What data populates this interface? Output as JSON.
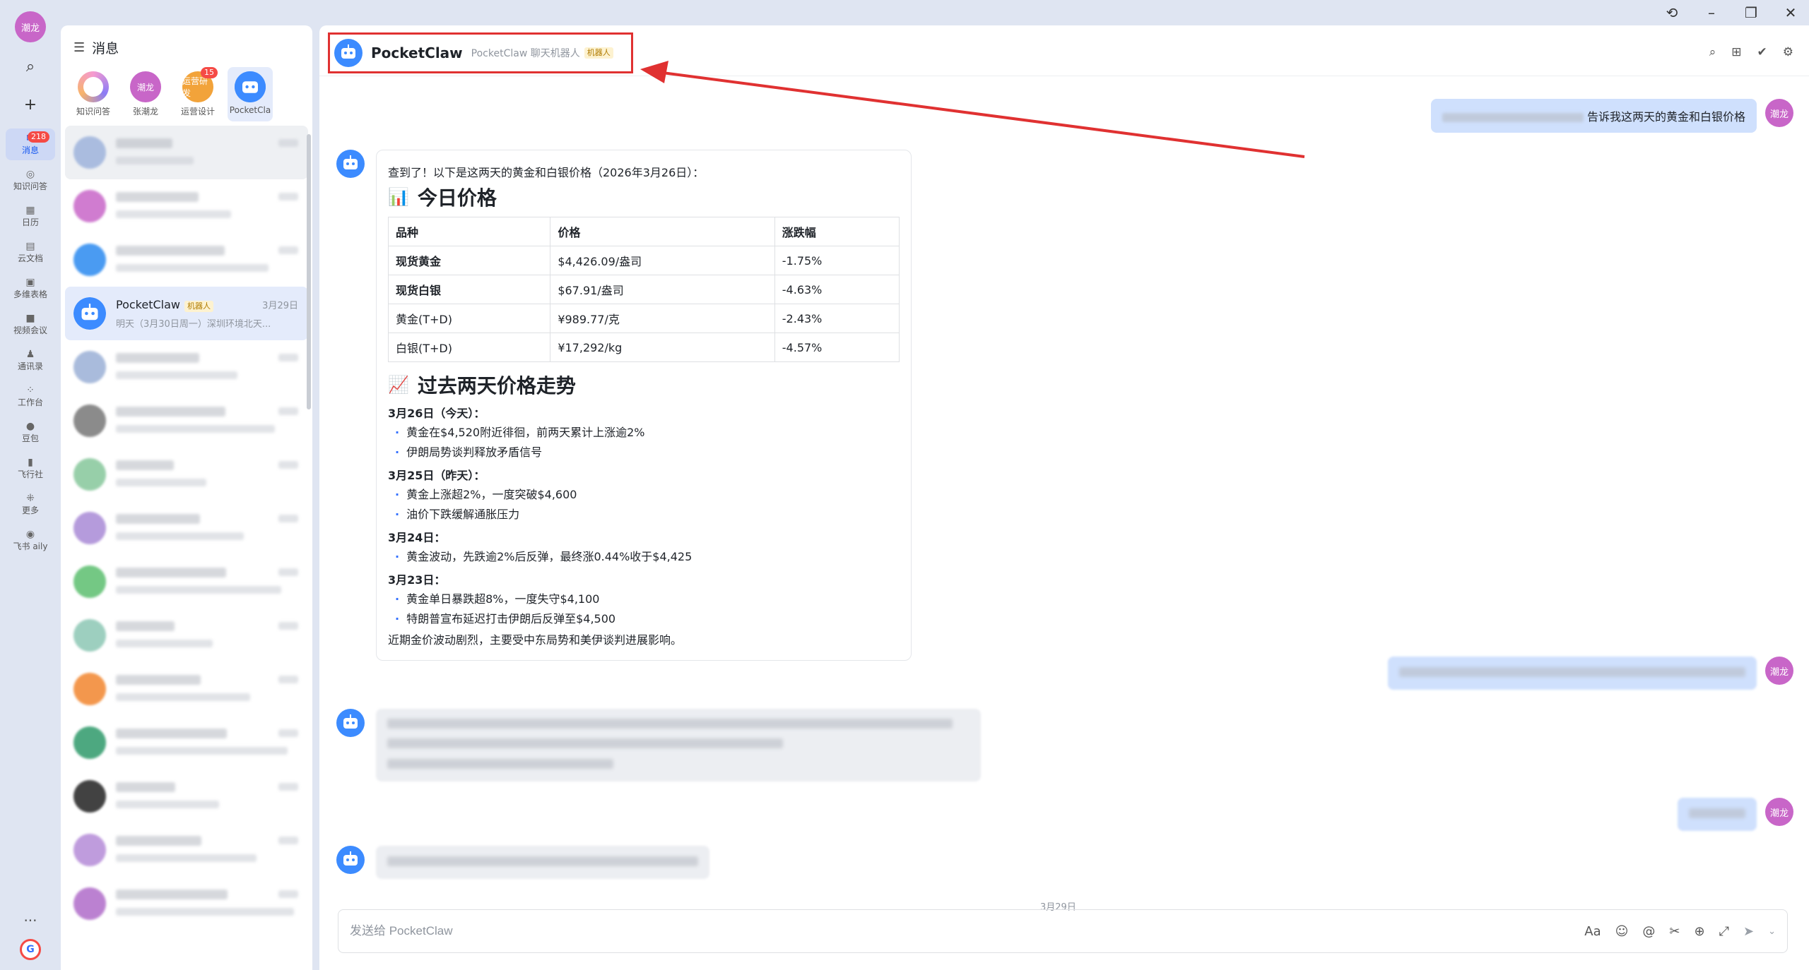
{
  "window": {
    "history_icon": "history-icon",
    "minimize": "–",
    "restore": "❐",
    "close": "✕"
  },
  "rail": {
    "me_avatar": "潮龙",
    "items": [
      {
        "label": "消息",
        "icon": "message-icon",
        "badge": "218",
        "active": true
      },
      {
        "label": "知识问答",
        "icon": "knowledge-icon"
      },
      {
        "label": "日历",
        "icon": "calendar-icon"
      },
      {
        "label": "云文档",
        "icon": "docs-icon"
      },
      {
        "label": "多维表格",
        "icon": "base-icon"
      },
      {
        "label": "视频会议",
        "icon": "video-icon"
      },
      {
        "label": "通讯录",
        "icon": "contacts-icon"
      },
      {
        "label": "工作台",
        "icon": "workplace-icon"
      },
      {
        "label": "豆包",
        "icon": "doubao-icon"
      },
      {
        "label": "飞行社",
        "icon": "club-icon"
      },
      {
        "label": "更多",
        "icon": "more-apps-icon"
      },
      {
        "label": "飞书 aily",
        "icon": "aily-icon"
      }
    ]
  },
  "list": {
    "title": "消息",
    "pins": [
      {
        "label": "知识问答",
        "avatar_text": "",
        "color": "#e6a0e0"
      },
      {
        "label": "张潮龙",
        "avatar_text": "潮龙",
        "color": "#c866c8"
      },
      {
        "label": "运营设计",
        "avatar_text": "运营研发",
        "color": "#f2a33a",
        "badge": "15"
      },
      {
        "label": "PocketCla",
        "avatar_text": "",
        "color": "#3c8bff",
        "active": true
      }
    ],
    "conversations": [
      {
        "name": "",
        "preview": "",
        "time": "",
        "color": "#9fb4dc"
      },
      {
        "name": "",
        "preview": "",
        "time": "",
        "color": "#c866c8"
      },
      {
        "name": "",
        "preview": "",
        "time": "",
        "color": "#2b8af0"
      },
      {
        "name": "PocketClaw",
        "tag": "机器人",
        "preview": "明天（3月30日周一）深圳环境北天...",
        "time": "3月29日",
        "color": "#3c8bff",
        "active": true
      },
      {
        "name": "",
        "preview": "",
        "time": "",
        "color": "#9bb0d6"
      },
      {
        "name": "",
        "preview": "",
        "time": "",
        "color": "#777"
      },
      {
        "name": "",
        "preview": "",
        "time": "",
        "color": "#86c79b"
      },
      {
        "name": "",
        "preview": "",
        "time": "",
        "color": "#a98ad6"
      },
      {
        "name": "",
        "preview": "",
        "time": "",
        "color": "#5cbf6f"
      },
      {
        "name": "",
        "preview": "",
        "time": "",
        "color": "#8cc7b4"
      },
      {
        "name": "",
        "preview": "",
        "time": "",
        "color": "#f2862e"
      },
      {
        "name": "",
        "preview": "",
        "time": "",
        "color": "#2e9a6a"
      },
      {
        "name": "",
        "preview": "",
        "time": "",
        "color": "#222"
      },
      {
        "name": "",
        "preview": "",
        "time": "",
        "color": "#b58bd8"
      },
      {
        "name": "",
        "preview": "",
        "time": "",
        "color": "#b06cc9"
      }
    ]
  },
  "chat": {
    "name": "PocketClaw",
    "subtitle": "PocketClaw 聊天机器人",
    "tag": "机器人",
    "self_avatar": "潮龙",
    "user_question": "告诉我这两天的黄金和白银价格",
    "reply": {
      "intro": "查到了！以下是这两天的黄金和白银价格（2026年3月26日）：",
      "heading1": "今日价格",
      "heading1_emoji": "📊",
      "table_headers": [
        "品种",
        "价格",
        "涨跌幅"
      ],
      "table_rows": [
        {
          "name": "现货黄金",
          "price": "$4,426.09/盎司",
          "change": "-1.75%"
        },
        {
          "name": "现货白银",
          "price": "$67.91/盎司",
          "change": "-4.63%"
        },
        {
          "name": "黄金(T+D)",
          "price": "¥989.77/克",
          "change": "-2.43%"
        },
        {
          "name": "白银(T+D)",
          "price": "¥17,292/kg",
          "change": "-4.57%"
        }
      ],
      "heading2": "过去两天价格走势",
      "heading2_emoji": "📈",
      "days": [
        {
          "title": "3月26日（今天）：",
          "bullets": [
            "黄金在$4,520附近徘徊，前两天累计上涨逾2%",
            "伊朗局势谈判释放矛盾信号"
          ]
        },
        {
          "title": "3月25日（昨天）：",
          "bullets": [
            "黄金上涨超2%，一度突破$4,600",
            "油价下跌缓解通胀压力"
          ]
        },
        {
          "title": "3月24日：",
          "bullets": [
            "黄金波动，先跌逾2%后反弹，最终涨0.44%收于$4,425"
          ]
        },
        {
          "title": "3月23日：",
          "bullets": [
            "黄金单日暴跌超8%，一度失守$4,100",
            "特朗普宣布延迟打击伊朗后反弹至$4,500"
          ]
        }
      ],
      "summary": "近期金价波动剧烈，主要受中东局势和美伊谈判进展影响。"
    },
    "date_divider": "3月29日",
    "composer_placeholder": "发送给 PocketClaw"
  }
}
